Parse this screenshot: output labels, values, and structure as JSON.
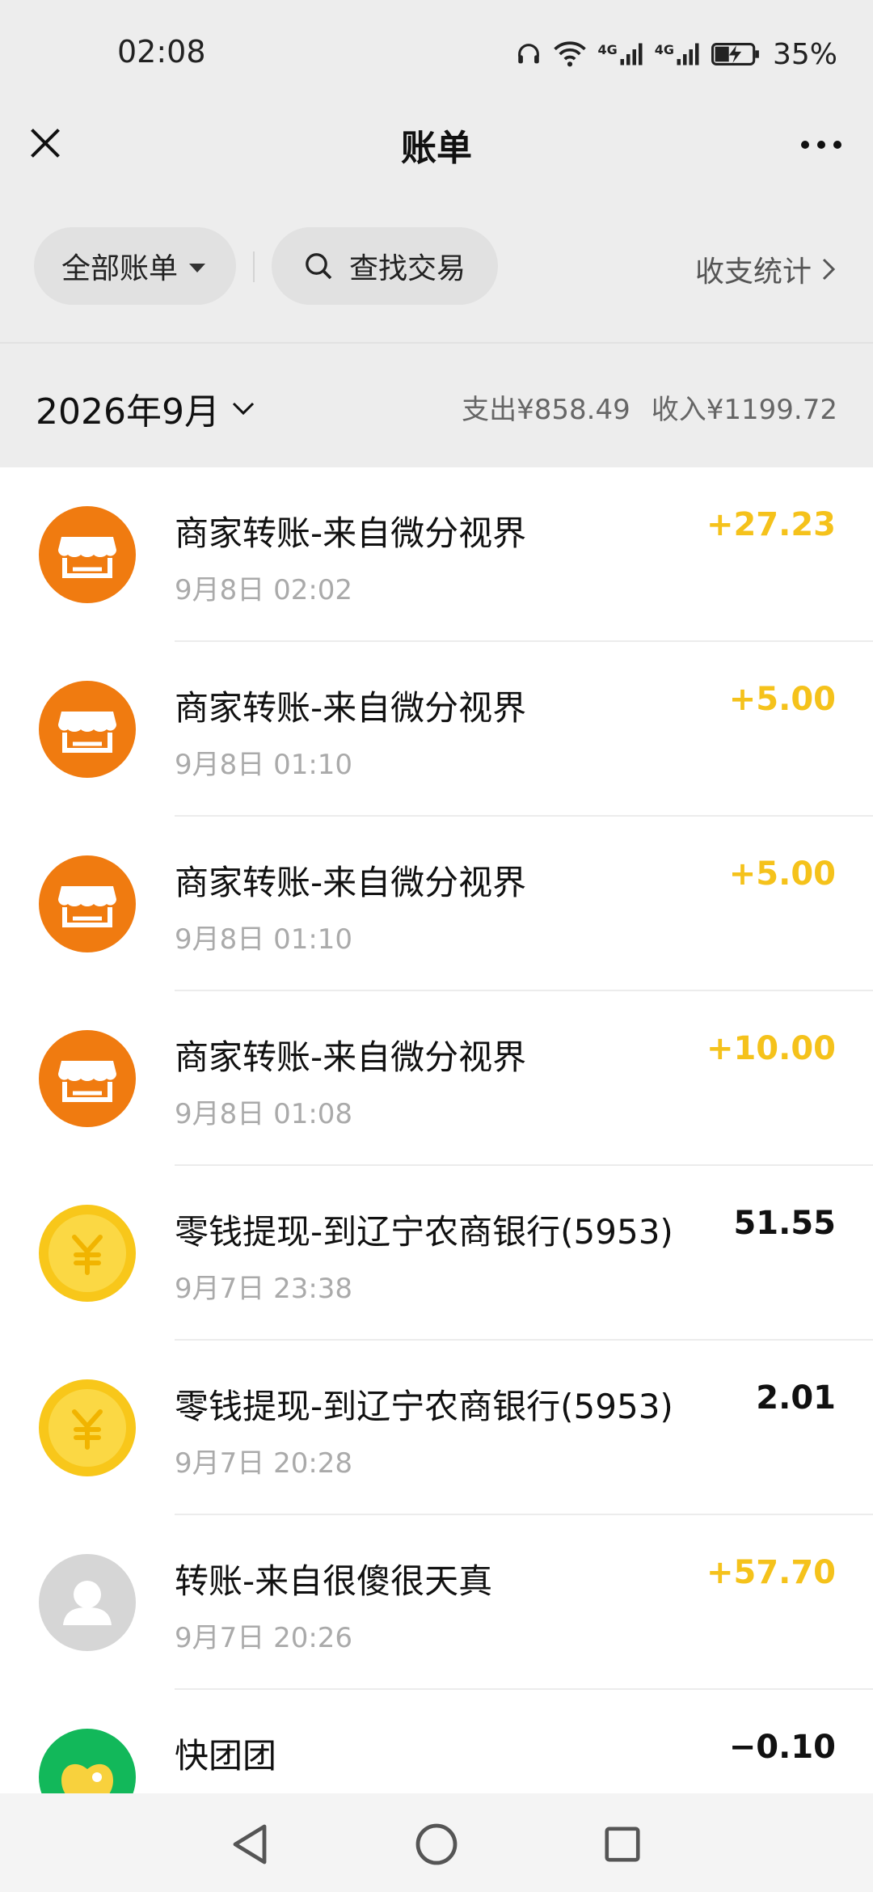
{
  "status_bar": {
    "time": "02:08",
    "battery_percent": "35%",
    "network_1": "4G",
    "network_2": "4G"
  },
  "header": {
    "title": "账单"
  },
  "filters": {
    "all_bills_label": "全部账单",
    "search_label": "查找交易",
    "stats_label": "收支统计"
  },
  "month": {
    "label": "2026年9月",
    "expense": "支出¥858.49",
    "income": "收入¥1199.72"
  },
  "colors": {
    "income": "#f5c21b",
    "merchant_icon": "#f07b10",
    "wallet_icon": "#f8c71a",
    "avatar_icon": "#d6d6d6",
    "kuaituan_icon": "#12b85a"
  },
  "transactions": [
    {
      "icon": "store-icon",
      "title": "商家转账-来自微分视界",
      "time": "9月8日 02:02",
      "amount": "+27.23",
      "income": true
    },
    {
      "icon": "store-icon",
      "title": "商家转账-来自微分视界",
      "time": "9月8日 01:10",
      "amount": "+5.00",
      "income": true
    },
    {
      "icon": "store-icon",
      "title": "商家转账-来自微分视界",
      "time": "9月8日 01:10",
      "amount": "+5.00",
      "income": true
    },
    {
      "icon": "store-icon",
      "title": "商家转账-来自微分视界",
      "time": "9月8日 01:08",
      "amount": "+10.00",
      "income": true
    },
    {
      "icon": "yuan-coin-icon",
      "title": "零钱提现-到辽宁农商银行(5953)",
      "time": "9月7日 23:38",
      "amount": "51.55",
      "income": false
    },
    {
      "icon": "yuan-coin-icon",
      "title": "零钱提现-到辽宁农商银行(5953)",
      "time": "9月7日 20:28",
      "amount": "2.01",
      "income": false
    },
    {
      "icon": "user-avatar-icon",
      "title": "转账-来自很傻很天真",
      "time": "9月7日 20:26",
      "amount": "+57.70",
      "income": true
    },
    {
      "icon": "kuaituantuan-icon",
      "title": "快团团",
      "time": "",
      "amount": "−0.10",
      "income": false
    }
  ]
}
